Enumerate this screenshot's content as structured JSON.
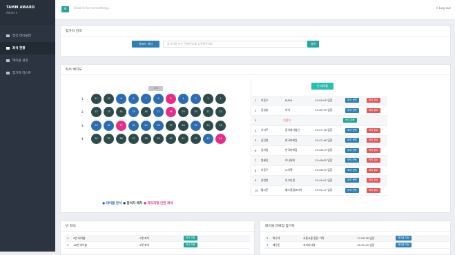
{
  "sidebar": {
    "brand": "TAMM AWARD",
    "user": "Admin ▾",
    "items": [
      {
        "label": "참석 테이블맵"
      },
      {
        "label": "좌석 현황"
      },
      {
        "label": "테이블 설정"
      },
      {
        "label": "참가자 리스트"
      }
    ]
  },
  "topbar": {
    "search_placeholder": "Search for something...",
    "logout": "Log out"
  },
  "search_panel": {
    "title": "참가자 검색",
    "scan_button": "바코드 리더",
    "input_placeholder": "참가자명 또는 전화번호를 입력해주세요",
    "go_button": "검색"
  },
  "seat_panel": {
    "title": "좌석 배치도",
    "stage": "무대",
    "assign_button": "빈 테이블",
    "rows": [
      {
        "num": "1",
        "seats": [
          {
            "n": "11",
            "s": "occ"
          },
          {
            "n": "10",
            "s": "occ"
          },
          {
            "n": "9",
            "s": "sel"
          },
          {
            "n": "8",
            "s": "sel"
          },
          {
            "n": "7",
            "s": "sel"
          },
          {
            "n": "6",
            "s": "sel"
          },
          {
            "n": "5",
            "s": "unav"
          },
          {
            "n": "4",
            "s": "sel"
          },
          {
            "n": "3",
            "s": "sel"
          },
          {
            "n": "2",
            "s": "occ"
          },
          {
            "n": "1",
            "s": "occ"
          }
        ]
      },
      {
        "num": "2",
        "seats": [
          {
            "n": "12",
            "s": "occ"
          },
          {
            "n": "13",
            "s": "occ"
          },
          {
            "n": "14",
            "s": "occ"
          },
          {
            "n": "15",
            "s": "sel"
          },
          {
            "n": "16",
            "s": "occ"
          },
          {
            "n": "17",
            "s": "sel"
          },
          {
            "n": "18",
            "s": "unav"
          },
          {
            "n": "19",
            "s": "occ"
          },
          {
            "n": "20",
            "s": "occ"
          },
          {
            "n": "21",
            "s": "occ"
          },
          {
            "n": "22",
            "s": "occ"
          }
        ]
      },
      {
        "num": "3",
        "seats": [
          {
            "n": "33",
            "s": "sel"
          },
          {
            "n": "32",
            "s": "sel"
          },
          {
            "n": "31",
            "s": "unav"
          },
          {
            "n": "30",
            "s": "sel"
          },
          {
            "n": "29",
            "s": "sel"
          },
          {
            "n": "28",
            "s": "sel"
          },
          {
            "n": "27",
            "s": "occ"
          },
          {
            "n": "26",
            "s": "occ"
          },
          {
            "n": "25",
            "s": "sel"
          },
          {
            "n": "24",
            "s": "occ"
          },
          {
            "n": "23",
            "s": "occ"
          }
        ]
      },
      {
        "num": "4",
        "seats": [
          {
            "n": "34",
            "s": "occ"
          },
          {
            "n": "35",
            "s": "occ"
          },
          {
            "n": "36",
            "s": "occ"
          },
          {
            "n": "37",
            "s": "occ"
          },
          {
            "n": "38",
            "s": "occ"
          },
          {
            "n": "39",
            "s": "occ"
          },
          {
            "n": "40",
            "s": "occ"
          },
          {
            "n": "41",
            "s": "occ"
          },
          {
            "n": "42",
            "s": "occ"
          },
          {
            "n": "43",
            "s": "sel"
          },
          {
            "n": "44",
            "s": "unav"
          }
        ]
      }
    ],
    "legend": {
      "blue": "● 테이블 완석",
      "black": "● 참석자 배치",
      "pink": "● 자리지정 안된 좌석"
    },
    "table": [
      {
        "no": "1",
        "name": "이동우",
        "dept": "KURA",
        "time": "15:09:05 입장",
        "a1": "좌석 선택",
        "a2": "좌석 취소"
      },
      {
        "no": "2",
        "name": "김성훈",
        "dept": "하키",
        "time": "15:45:59 입장",
        "a1": "좌석 선택",
        "a2": "좌석 취소"
      },
      {
        "no": "3",
        "empty": "미참석",
        "a1": "좌석 지정"
      },
      {
        "no": "4",
        "name": "이서주",
        "dept": "참석회사법인",
        "time": "15:47:16 입장",
        "a1": "좌석 선택",
        "a2": "좌석 취소"
      },
      {
        "no": "5",
        "name": "김진원",
        "dept": "한국마케팅",
        "time": "15:47:46 입장",
        "a1": "좌석 선택",
        "a2": "좌석 취소"
      },
      {
        "no": "6",
        "name": "김지원",
        "dept": "한국마케팅",
        "time": "15:48:23 입장",
        "a1": "좌석 선택",
        "a2": "좌석 취소"
      },
      {
        "no": "7",
        "name": "원혜진",
        "dept": "하나롯데",
        "time": "15:48:05 입장",
        "a1": "좌석 선택",
        "a2": "좌석 취소"
      },
      {
        "no": "8",
        "name": "이동우",
        "dept": "노아펫",
        "time": "15:48:23 입장",
        "a1": "좌석 선택",
        "a2": "좌석 취소"
      },
      {
        "no": "9",
        "name": "손영훈",
        "dept": "인크인생",
        "time": "15:49:01 입장",
        "a1": "좌석 선택",
        "a2": "좌석 취소"
      },
      {
        "no": "10",
        "name": "황시준",
        "dept": "헬스클럽코리아",
        "time": "15:51:27 입장",
        "a1": "좌석 선택",
        "a2": "좌석 취소"
      }
    ]
  },
  "empty_panel": {
    "title": "빈 좌석",
    "rows": [
      {
        "no": "1",
        "name": "5번 테이블",
        "count": "2명 좌석",
        "action": "좌석 지정"
      },
      {
        "no": "2",
        "name": "18번 테이블",
        "count": "5명 좌석",
        "action": "좌석 지정"
      }
    ]
  },
  "unassigned_panel": {
    "title": "테이블 미배정 참가자",
    "rows": [
      {
        "no": "1",
        "name": "최우석",
        "dept": "서울시물 합동 기획",
        "time": "17:06:38 입장",
        "action": "테이블 지정"
      },
      {
        "no": "2",
        "name": "배우준",
        "dept": "코리아타워",
        "time": "16:30:40 입장",
        "action": "테이블 지정"
      }
    ]
  },
  "colors": {
    "teal": "#26a69a",
    "blue": "#2b6cb3",
    "dark": "#2e4a4a",
    "pink": "#e52d8a",
    "red": "#e05a5a",
    "sidebar": "#2b3440"
  }
}
